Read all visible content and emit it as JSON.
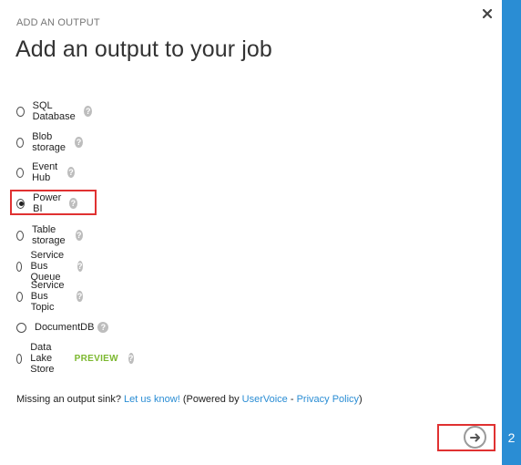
{
  "header": {
    "subtitle": "ADD AN OUTPUT",
    "title": "Add an output to your job"
  },
  "options": [
    {
      "label": "SQL Database",
      "selected": false
    },
    {
      "label": "Blob storage",
      "selected": false
    },
    {
      "label": "Event Hub",
      "selected": false
    },
    {
      "label": "Power BI",
      "selected": true
    },
    {
      "label": "Table storage",
      "selected": false
    },
    {
      "label": "Service Bus Queue",
      "selected": false
    },
    {
      "label": "Service Bus Topic",
      "selected": false
    },
    {
      "label": "DocumentDB",
      "selected": false
    },
    {
      "label": "Data Lake Store",
      "selected": false,
      "badge": "PREVIEW"
    }
  ],
  "help_glyph": "?",
  "footer": {
    "prefix": "Missing an output sink? ",
    "let_us_know": "Let us know!",
    "powered_by": " (Powered by ",
    "uservoice": "UserVoice",
    "separator": " - ",
    "privacy": "Privacy Policy",
    "close_paren": ")"
  },
  "sidebar": {
    "step": "2"
  },
  "colors": {
    "accent": "#2a8dd4",
    "preview": "#7cb82f",
    "highlight": "#e03131"
  },
  "icons": {
    "close": "close-icon",
    "next": "arrow-right-icon",
    "help": "help-icon"
  }
}
